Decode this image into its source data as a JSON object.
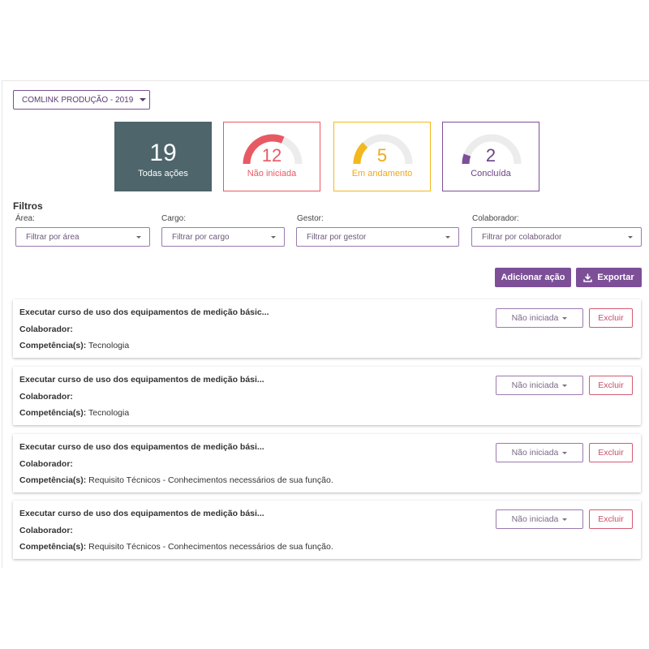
{
  "project": {
    "label": "COMLINK PRODUÇÃO - 2019"
  },
  "stats": {
    "total": {
      "value": "19",
      "label": "Todas ações"
    },
    "not_started": {
      "value": "12",
      "label": "Não iniciada",
      "fraction": 0.63,
      "color": "#e85a63"
    },
    "in_progress": {
      "value": "5",
      "label": "Em andamento",
      "fraction": 0.26,
      "color": "#f3b81e"
    },
    "done": {
      "value": "2",
      "label": "Concluída",
      "fraction": 0.11,
      "color": "#7c4f97"
    }
  },
  "filters": {
    "title": "Filtros",
    "area": {
      "label": "Área:",
      "placeholder": "Filtrar por área"
    },
    "cargo": {
      "label": "Cargo:",
      "placeholder": "Filtrar por cargo"
    },
    "gestor": {
      "label": "Gestor:",
      "placeholder": "Filtrar por gestor"
    },
    "colaborador": {
      "label": "Colaborador:",
      "placeholder": "Filtrar por colaborador"
    }
  },
  "toolbar": {
    "add_label": "Adicionar ação",
    "export_label": "Exportar"
  },
  "actions": [
    {
      "title": "Executar curso de uso dos equipamentos de medição básic...",
      "collaborator_label": "Colaborador:",
      "competence_label": "Competência(s):",
      "competence_value": " Tecnologia",
      "status": "Não iniciada",
      "delete_label": "Excluir"
    },
    {
      "title": "Executar curso de uso dos equipamentos de medição bási...",
      "collaborator_label": "Colaborador:",
      "competence_label": "Competência(s):",
      "competence_value": " Tecnologia",
      "status": "Não iniciada",
      "delete_label": "Excluir"
    },
    {
      "title": "Executar curso de uso dos equipamentos de medição bási...",
      "collaborator_label": "Colaborador:",
      "competence_label": "Competência(s):",
      "competence_value": " Requisito Técnicos - Conhecimentos necessários de sua função.",
      "status": "Não iniciada",
      "delete_label": "Excluir"
    },
    {
      "title": "Executar curso de uso dos equipamentos de medição bási...",
      "collaborator_label": "Colaborador:",
      "competence_label": "Competência(s):",
      "competence_value": " Requisito Técnicos - Conhecimentos necessários de sua função.",
      "status": "Não iniciada",
      "delete_label": "Excluir"
    }
  ],
  "colors": {
    "primary": "#7c4f97",
    "total_card": "#4d656b",
    "danger": "#d45a73"
  },
  "icons": {
    "dropdown": "caret-down-icon",
    "export": "download-icon"
  }
}
